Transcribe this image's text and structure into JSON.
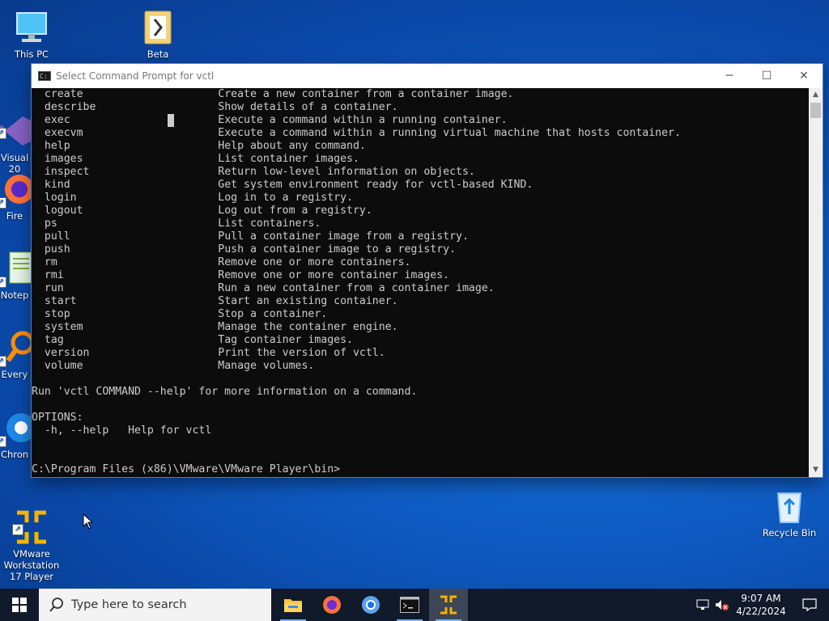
{
  "desktop": {
    "icons": [
      {
        "label": "This PC"
      },
      {
        "label": "Beta"
      },
      {
        "label": "Visual\n20"
      },
      {
        "label": "Fire"
      },
      {
        "label": "Notep"
      },
      {
        "label": "Every"
      },
      {
        "label": "Chron"
      },
      {
        "label": "VMware\nWorkstation\n17 Player"
      },
      {
        "label": "Recycle Bin"
      }
    ]
  },
  "window": {
    "title": "Select Command Prompt for vctl",
    "minimize_glyph": "─",
    "maximize_glyph": "☐",
    "close_glyph": "✕"
  },
  "console": {
    "commands": [
      {
        "name": "create",
        "desc": "Create a new container from a container image."
      },
      {
        "name": "describe",
        "desc": "Show details of a container."
      },
      {
        "name": "exec",
        "desc": "Execute a command within a running container."
      },
      {
        "name": "execvm",
        "desc": "Execute a command within a running virtual machine that hosts container."
      },
      {
        "name": "help",
        "desc": "Help about any command."
      },
      {
        "name": "images",
        "desc": "List container images."
      },
      {
        "name": "inspect",
        "desc": "Return low-level information on objects."
      },
      {
        "name": "kind",
        "desc": "Get system environment ready for vctl-based KIND."
      },
      {
        "name": "login",
        "desc": "Log in to a registry."
      },
      {
        "name": "logout",
        "desc": "Log out from a registry."
      },
      {
        "name": "ps",
        "desc": "List containers."
      },
      {
        "name": "pull",
        "desc": "Pull a container image from a registry."
      },
      {
        "name": "push",
        "desc": "Push a container image to a registry."
      },
      {
        "name": "rm",
        "desc": "Remove one or more containers."
      },
      {
        "name": "rmi",
        "desc": "Remove one or more container images."
      },
      {
        "name": "run",
        "desc": "Run a new container from a container image."
      },
      {
        "name": "start",
        "desc": "Start an existing container."
      },
      {
        "name": "stop",
        "desc": "Stop a container."
      },
      {
        "name": "system",
        "desc": "Manage the container engine."
      },
      {
        "name": "tag",
        "desc": "Tag container images."
      },
      {
        "name": "version",
        "desc": "Print the version of vctl."
      },
      {
        "name": "volume",
        "desc": "Manage volumes."
      }
    ],
    "more_info": "Run 'vctl COMMAND --help' for more information on a command.",
    "options_header": "OPTIONS:",
    "options_line": "  -h, --help   Help for vctl",
    "prompt": "C:\\Program Files (x86)\\VMware\\VMware Player\\bin>"
  },
  "taskbar": {
    "search_placeholder": "Type here to search",
    "time": "9:07 AM",
    "date": "4/22/2024",
    "apps": [
      "file-explorer",
      "firefox",
      "chrome",
      "command-prompt",
      "vmware-workstation-player"
    ]
  }
}
